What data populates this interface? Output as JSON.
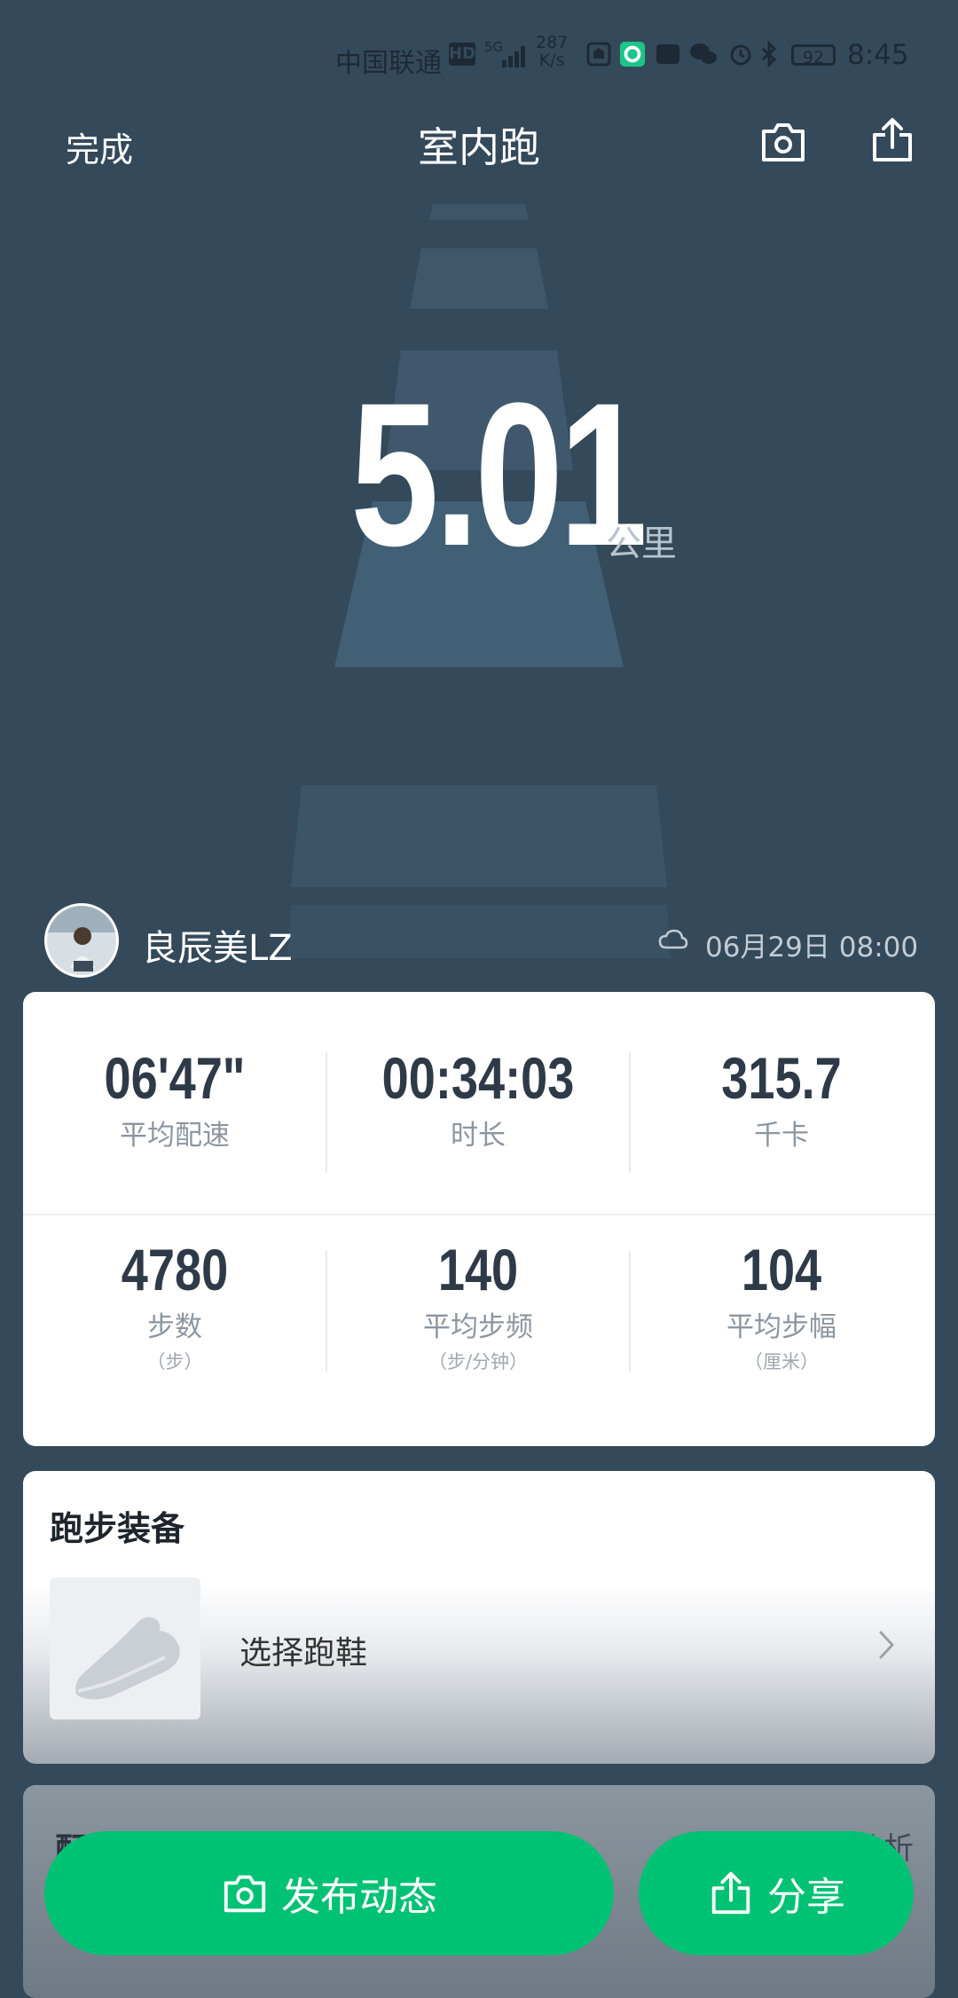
{
  "status_bar": {
    "carrier": "中国联通",
    "hd": "HD",
    "network": "5G",
    "speed_value": "287",
    "speed_unit": "K/s",
    "battery": "92",
    "time": "8:45"
  },
  "header": {
    "done_label": "完成",
    "title": "室内跑"
  },
  "distance": {
    "value": "5.01",
    "unit": "公里"
  },
  "user": {
    "name": "良辰美LZ",
    "datetime": "06月29日 08:00"
  },
  "stats": {
    "pace": {
      "value": "06'47\"",
      "label": "平均配速"
    },
    "duration": {
      "value": "00:34:03",
      "label": "时长"
    },
    "calories": {
      "value": "315.7",
      "label": "千卡"
    },
    "steps": {
      "value": "4780",
      "label": "步数",
      "unit": "（步）"
    },
    "cadence": {
      "value": "140",
      "label": "平均步频",
      "unit": "（步/分钟）"
    },
    "stride": {
      "value": "104",
      "label": "平均步幅",
      "unit": "（厘米）"
    }
  },
  "gear": {
    "title": "跑步装备",
    "select_label": "选择跑鞋"
  },
  "partial": {
    "left": "配速",
    "right": "配速分析"
  },
  "actions": {
    "post_label": "发布动态",
    "share_label": "分享"
  },
  "colors": {
    "background": "#34495a",
    "accent": "#00c274"
  }
}
